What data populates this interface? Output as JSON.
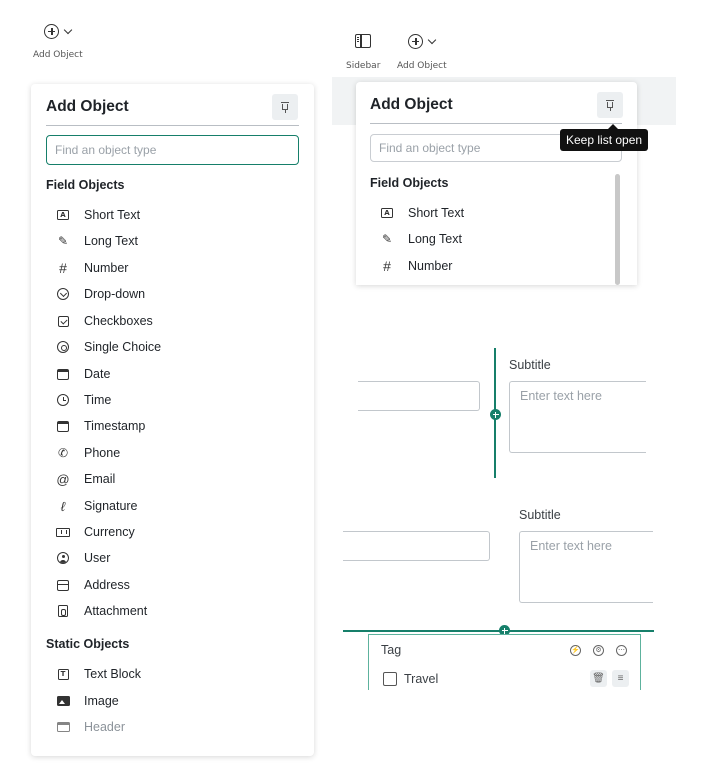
{
  "toolbar_left": {
    "add_object_label": "Add Object"
  },
  "toolbar_right": {
    "sidebar_label": "Sidebar",
    "add_object_label": "Add Object"
  },
  "panel_left": {
    "title": "Add Object",
    "search_placeholder": "Find an object type",
    "field_section": "Field Objects",
    "field_items": [
      {
        "label": "Short Text",
        "icon": "short-text-icon"
      },
      {
        "label": "Long Text",
        "icon": "long-text-icon"
      },
      {
        "label": "Number",
        "icon": "hash-icon"
      },
      {
        "label": "Drop-down",
        "icon": "dropdown-icon"
      },
      {
        "label": "Checkboxes",
        "icon": "checkbox-icon"
      },
      {
        "label": "Single Choice",
        "icon": "radio-icon"
      },
      {
        "label": "Date",
        "icon": "calendar-icon"
      },
      {
        "label": "Time",
        "icon": "clock-icon"
      },
      {
        "label": "Timestamp",
        "icon": "timestamp-icon"
      },
      {
        "label": "Phone",
        "icon": "phone-icon"
      },
      {
        "label": "Email",
        "icon": "at-icon"
      },
      {
        "label": "Signature",
        "icon": "signature-icon"
      },
      {
        "label": "Currency",
        "icon": "currency-icon"
      },
      {
        "label": "User",
        "icon": "user-icon"
      },
      {
        "label": "Address",
        "icon": "address-icon"
      },
      {
        "label": "Attachment",
        "icon": "attachment-icon"
      }
    ],
    "static_section": "Static Objects",
    "static_items": [
      {
        "label": "Text Block",
        "icon": "text-block-icon"
      },
      {
        "label": "Image",
        "icon": "image-icon"
      },
      {
        "label": "Header",
        "icon": "header-icon"
      }
    ]
  },
  "panel_right": {
    "title": "Add Object",
    "search_placeholder": "Find an object type",
    "field_section": "Field Objects",
    "items": [
      {
        "label": "Short Text"
      },
      {
        "label": "Long Text"
      },
      {
        "label": "Number"
      }
    ]
  },
  "tooltip": {
    "text": "Keep list open"
  },
  "form": {
    "subtitle_1": "Subtitle",
    "placeholder_1": "Enter text here",
    "subtitle_2": "Subtitle",
    "placeholder_2": "Enter text here",
    "tag_label": "Tag",
    "tag_option": "Travel"
  },
  "colors": {
    "accent": "#167f6a",
    "tag_border": "#5db29d"
  }
}
